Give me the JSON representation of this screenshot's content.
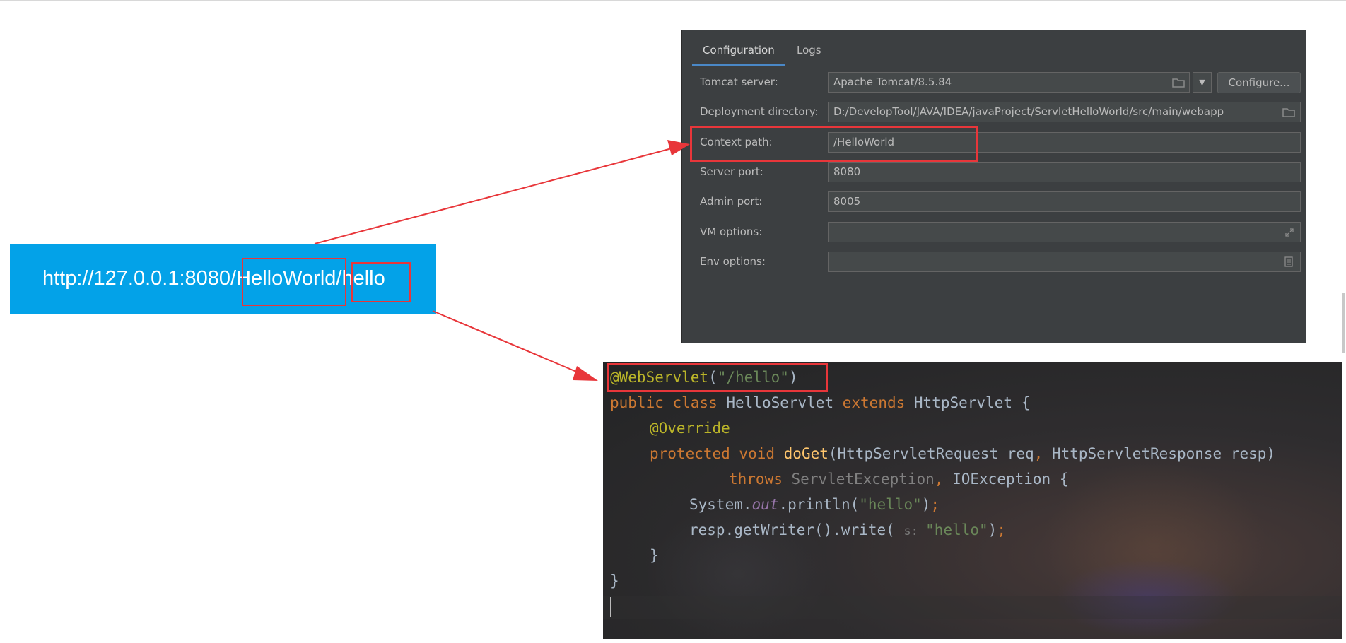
{
  "url": {
    "prefix": "http://127.0.0.1:8080/",
    "context": "HelloWorld",
    "slash": "/",
    "path": "hello"
  },
  "config_panel": {
    "tabs": [
      {
        "label": "Configuration",
        "active": true
      },
      {
        "label": "Logs",
        "active": false
      }
    ],
    "rows": {
      "tomcat_server": {
        "label": "Tomcat server:",
        "value": "Apache Tomcat/8.5.84"
      },
      "deployment_directory": {
        "label": "Deployment directory:",
        "value": "D:/DevelopTool/JAVA/IDEA/javaProject/ServletHelloWorld/src/main/webapp"
      },
      "context_path": {
        "label": "Context path:",
        "value": "/HelloWorld"
      },
      "server_port": {
        "label": "Server port:",
        "value": "8080"
      },
      "admin_port": {
        "label": "Admin port:",
        "value": "8005"
      },
      "vm_options": {
        "label": "VM options:",
        "value": ""
      },
      "env_options": {
        "label": "Env options:",
        "value": ""
      }
    },
    "configure_label": "Configure...",
    "dropdown_glyph": "▼",
    "icons": {
      "folder": "folder-icon",
      "expand": "expand-icon",
      "document": "document-icon"
    }
  },
  "code": {
    "line1": {
      "ann": "@WebServlet",
      "open": "(",
      "str": "\"/hello\"",
      "close": ")"
    },
    "line2": {
      "kw1": "public class ",
      "name": "HelloServlet ",
      "kw2": "extends ",
      "rest": "HttpServlet {"
    },
    "line3": {
      "ann": "@Override"
    },
    "line4": {
      "kw": "protected void ",
      "fn": "doGet",
      "args1": "(HttpServletRequest req",
      "comma": ", ",
      "args2": "HttpServletResponse resp)"
    },
    "line5": {
      "kw": "throws ",
      "dim": "ServletException",
      "comma": ", ",
      "rest": "IOException {"
    },
    "line6": {
      "a": "System.",
      "field": "out",
      "b": ".println(",
      "str": "\"hello\"",
      "c": ")",
      "semi": ";"
    },
    "line7": {
      "a": "resp.getWriter().write( ",
      "hint": "s: ",
      "str": "\"hello\"",
      "c": ")",
      "semi": ";"
    },
    "line8": {
      "text": "}"
    },
    "line9": {
      "text": "}"
    }
  },
  "colors": {
    "banner": "#03a2e8",
    "highlight": "#e8363a",
    "panel_bg": "#3c3f41",
    "keyword": "#cc7832",
    "annotation": "#bbb529",
    "string": "#6a8759"
  }
}
